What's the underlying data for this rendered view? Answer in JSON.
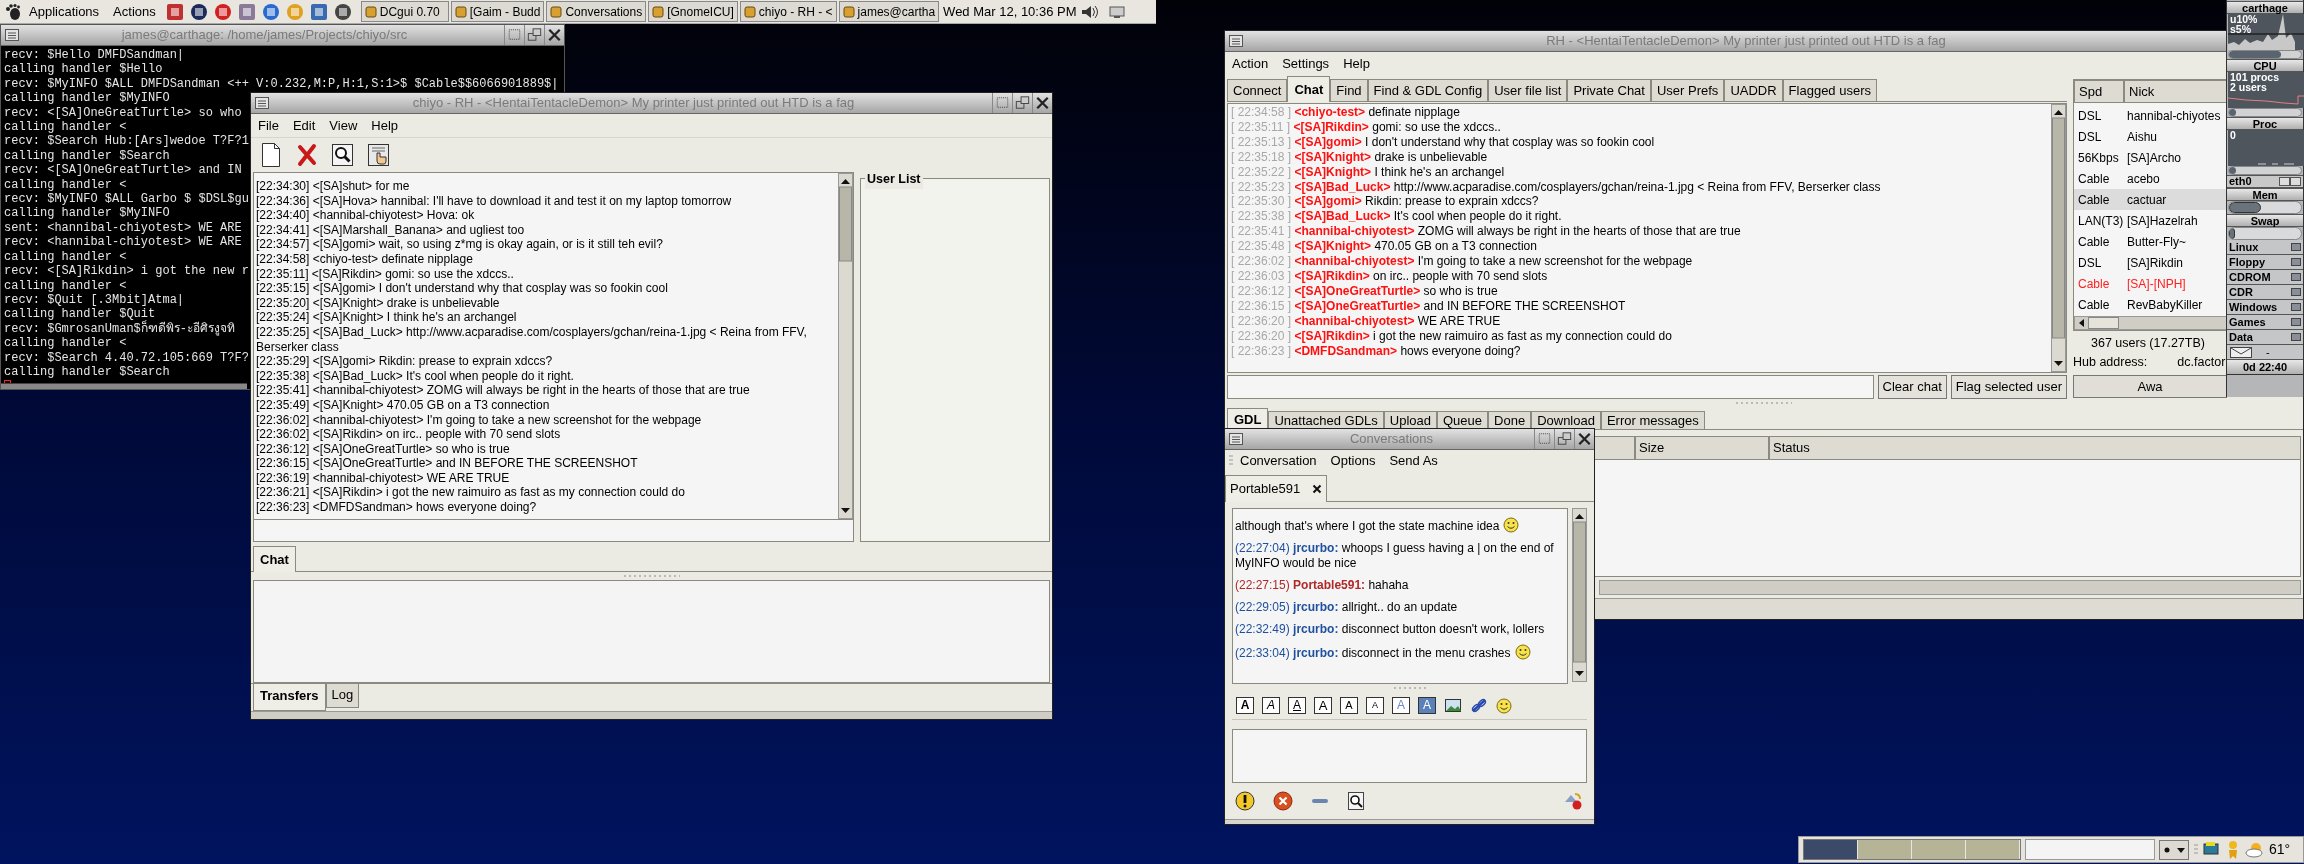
{
  "top_panel": {
    "menus": [
      "Applications",
      "Actions"
    ],
    "tasks": [
      "DCgui 0.70",
      "[Gaim - Budd",
      "Conversations",
      "[GnomeICU]",
      "chiyo - RH - <",
      "james@cartha"
    ],
    "clock": "Wed Mar 12, 10:36 PM"
  },
  "terminal": {
    "title": "james@carthage: /home/james/Projects/chiyo/src",
    "lines": [
      "recv: $Hello DMFDSandman|",
      "calling handler $Hello",
      "recv: $MyINFO $ALL DMFDSandman <++ V:0.232,M:P,H:1,S:1>$ $Cable$$6066901889$|",
      "calling handler $MyINFO",
      "recv: <[SA]OneGreatTurtle> so who",
      "calling handler <",
      "recv: $Search Hub:[Ars]wedoe T?F?1",
      "calling handler $Search",
      "recv: <[SA]OneGreatTurtle> and IN",
      "calling handler <",
      "recv: $MyINFO $ALL Garbo $ $DSL$gu",
      "calling handler $MyINFO",
      "sent: <hannibal-chiyotest> WE ARE",
      "recv: <hannibal-chiyotest> WE ARE",
      "calling handler <",
      "recv: <[SA]Rikdin> i got the new r",
      "calling handler <",
      "recv: $Quit [.3Mbit]Atma|",
      "calling handler $Quit",
      "recv: $GmrosanUman$ก็ฑดีพิร-ะอีศิรงูจทิ",
      "calling handler <",
      "recv: $Search 4.40.72.105:669 T?F?",
      "calling handler $Search"
    ]
  },
  "chiyo": {
    "title": "chiyo - RH - <HentaiTentacleDemon> My printer just printed out HTD is a fag",
    "menus": [
      "File",
      "Edit",
      "View",
      "Help"
    ],
    "lines": [
      "[22:34:30] <[SA]shut> for me",
      "[22:34:36] <[SA]Hova> hannibal:  I'll have to download it and test it on my laptop tomorrow",
      "[22:34:40] <hannibal-chiyotest> Hova: ok",
      "[22:34:41] <[SA]Marshall_Banana> and ugliest too",
      "[22:34:57] <[SA]gomi> wait, so using z*mg is okay again, or is it still teh evil?",
      "[22:34:58] <chiyo-test> definate nipplage",
      "[22:35:11] <[SA]Rikdin> gomi: so use the xdccs..",
      "[22:35:15] <[SA]gomi> I don't understand why that cosplay was so fookin cool",
      "[22:35:20] <[SA]Knight> drake is unbelievable",
      "[22:35:24] <[SA]Knight> I think he's an archangel",
      "[22:35:25] <[SA]Bad_Luck> http://www.acparadise.com/cosplayers/gchan/reina-1.jpg < Reina from FFV, Berserker class",
      "[22:35:29] <[SA]gomi> Rikdin: prease to exprain xdccs?",
      "[22:35:38] <[SA]Bad_Luck> It's cool when people do it right.",
      "[22:35:41] <hannibal-chiyotest> ZOMG will always be right in the hearts of those that are true",
      "[22:35:49] <[SA]Knight> 470.05 GB on a T3 connection",
      "[22:36:02] <hannibal-chiyotest> I'm going to take a new screenshot for the webpage",
      "[22:36:02] <[SA]Rikdin> on irc.. people with 70 send slots",
      "[22:36:12] <[SA]OneGreatTurtle> so who is true",
      "[22:36:15] <[SA]OneGreatTurtle> and IN BEFORE THE SCREENSHOT",
      "[22:36:19] <hannibal-chiyotest> WE ARE TRUE",
      "[22:36:21] <[SA]Rikdin> i got the new raimuiro as fast as my connection could do",
      "[22:36:23] <DMFDSandman> hows everyone doing?"
    ],
    "user_list_title": "User List",
    "chat_tabs": [
      {
        "label": "Chat",
        "selected": true
      }
    ],
    "bottom_tabs": [
      {
        "label": "Transfers",
        "selected": true
      },
      {
        "label": "Log",
        "selected": false
      }
    ]
  },
  "rh": {
    "title": "RH - <HentaiTentacleDemon> My printer just printed out HTD is a fag",
    "menus": [
      "Action",
      "Settings",
      "Help"
    ],
    "tabs": [
      {
        "label": "Connect",
        "selected": false
      },
      {
        "label": "Chat",
        "selected": true
      },
      {
        "label": "Find",
        "selected": false
      },
      {
        "label": "Find & GDL Config",
        "selected": false
      },
      {
        "label": "User file list",
        "selected": false
      },
      {
        "label": "Private Chat",
        "selected": false
      },
      {
        "label": "User Prefs",
        "selected": false
      },
      {
        "label": "UADDR",
        "selected": false
      },
      {
        "label": "Flagged users",
        "selected": false
      }
    ],
    "messages": [
      {
        "time": "[ 22:34:58 ]",
        "nick": "<chiyo-test>",
        "text": "definate nipplage"
      },
      {
        "time": "[ 22:35:11 ]",
        "nick": "<[SA]Rikdin>",
        "text": "gomi: so use the xdccs.."
      },
      {
        "time": "[ 22:35:13 ]",
        "nick": "<[SA]gomi>",
        "text": "I don't understand why that cosplay was so fookin cool"
      },
      {
        "time": "[ 22:35:18 ]",
        "nick": "<[SA]Knight>",
        "text": "drake is unbelievable"
      },
      {
        "time": "[ 22:35:22 ]",
        "nick": "<[SA]Knight>",
        "text": "I think he's an archangel"
      },
      {
        "time": "[ 22:35:23 ]",
        "nick": "<[SA]Bad_Luck>",
        "text": "http://www.acparadise.com/cosplayers/gchan/reina-1.jpg < Reina from FFV, Berserker class"
      },
      {
        "time": "[ 22:35:30 ]",
        "nick": "<[SA]gomi>",
        "text": "Rikdin: prease to exprain xdccs?"
      },
      {
        "time": "[ 22:35:38 ]",
        "nick": "<[SA]Bad_Luck>",
        "text": "It's cool when people do it right."
      },
      {
        "time": "[ 22:35:41 ]",
        "nick": "<hannibal-chiyotest>",
        "text": "ZOMG will always be right in the hearts of those that are true"
      },
      {
        "time": "[ 22:35:48 ]",
        "nick": "<[SA]Knight>",
        "text": "470.05 GB on a T3 connection"
      },
      {
        "time": "[ 22:36:02 ]",
        "nick": "<hannibal-chiyotest>",
        "text": "I'm going to take a new screenshot for the webpage"
      },
      {
        "time": "[ 22:36:03 ]",
        "nick": "<[SA]Rikdin>",
        "text": "on irc.. people with 70 send slots"
      },
      {
        "time": "[ 22:36:12 ]",
        "nick": "<[SA]OneGreatTurtle>",
        "text": "so who is true"
      },
      {
        "time": "[ 22:36:15 ]",
        "nick": "<[SA]OneGreatTurtle>",
        "text": "and IN BEFORE THE SCREENSHOT"
      },
      {
        "time": "[ 22:36:20 ]",
        "nick": "<hannibal-chiyotest>",
        "text": "WE ARE TRUE"
      },
      {
        "time": "[ 22:36:20 ]",
        "nick": "<[SA]Rikdin>",
        "text": "i got the new raimuiro as fast as my connection could do"
      },
      {
        "time": "[ 22:36:23 ]",
        "nick": "<DMFDSandman>",
        "text": "hows everyone doing?"
      }
    ],
    "buttons": [
      "Clear chat",
      "Flag selected user"
    ],
    "user_columns": [
      "Spd",
      "Nick"
    ],
    "users": [
      {
        "speed": "DSL",
        "nick": "hannibal-chiyotes",
        "selected": false,
        "color": "#000000"
      },
      {
        "speed": "DSL",
        "nick": "Aishu",
        "selected": false,
        "color": "#000000"
      },
      {
        "speed": "56Kbps",
        "nick": "[SA]Archo",
        "selected": false,
        "color": "#000000"
      },
      {
        "speed": "Cable",
        "nick": "acebo",
        "selected": false,
        "color": "#000000"
      },
      {
        "speed": "Cable",
        "nick": "cactuar",
        "selected": true,
        "color": "#000000"
      },
      {
        "speed": "LAN(T3)",
        "nick": "[SA]Hazelrah",
        "selected": false,
        "color": "#000000"
      },
      {
        "speed": "Cable",
        "nick": "Butter-Fly~",
        "selected": false,
        "color": "#000000"
      },
      {
        "speed": "DSL",
        "nick": "[SA]Rikdin",
        "selected": false,
        "color": "#000000"
      },
      {
        "speed": "Cable",
        "nick": "[SA]-[NPH]",
        "selected": false,
        "color": "#ff2020"
      },
      {
        "speed": "Cable",
        "nick": "RevBabyKiller",
        "selected": false,
        "color": "#000000"
      }
    ],
    "user_count": "367 users (17.27TB)",
    "hub_label": "Hub address:",
    "hub_value": "dc.factor",
    "away_button": "Awa",
    "transfer_tabs": [
      {
        "label": "GDL",
        "selected": true
      },
      {
        "label": "Unattached GDLs",
        "selected": false
      },
      {
        "label": "Upload",
        "selected": false
      },
      {
        "label": "Queue",
        "selected": false
      },
      {
        "label": "Done",
        "selected": false
      },
      {
        "label": "Download",
        "selected": false
      },
      {
        "label": "Error messages",
        "selected": false
      }
    ],
    "transfer_columns": [
      "Size",
      "Status"
    ]
  },
  "conversations": {
    "title": "Conversations",
    "menus": [
      "Conversation",
      "Options",
      "Send As"
    ],
    "tab": "Portable591",
    "messages": [
      {
        "kind": "continuation",
        "text": "although that's where I got the state machine idea",
        "has_smiley": true
      },
      {
        "kind": "message",
        "time": "(22:27:04)",
        "sender": "jrcurbo:",
        "text": "whoops I guess having a | on the end of MyINFO would be nice",
        "color": "#1f4f9f",
        "has_smiley": false
      },
      {
        "kind": "message",
        "time": "(22:27:15)",
        "sender": "Portable591:",
        "text": "hahaha",
        "color": "#b02828",
        "has_smiley": false
      },
      {
        "kind": "message",
        "time": "(22:29:05)",
        "sender": "jrcurbo:",
        "text": "allright.. do an update",
        "color": "#1f4f9f",
        "has_smiley": false
      },
      {
        "kind": "message",
        "time": "(22:32:49)",
        "sender": "jrcurbo:",
        "text": "disconnect button doesn't work, lollers",
        "color": "#1f4f9f",
        "has_smiley": false
      },
      {
        "kind": "message",
        "time": "(22:33:04)",
        "sender": "jrcurbo:",
        "text": "disconnect in the menu crashes",
        "color": "#1f4f9f",
        "has_smiley": true
      }
    ],
    "format_buttons": [
      {
        "kind": "bold",
        "glyph": "A"
      },
      {
        "kind": "italic",
        "glyph": "A"
      },
      {
        "kind": "underline",
        "glyph": "A"
      },
      {
        "kind": "larger",
        "glyph": "A"
      },
      {
        "kind": "normal",
        "glyph": "A"
      },
      {
        "kind": "smaller",
        "glyph": "A"
      },
      {
        "kind": "foreground",
        "glyph": "A"
      },
      {
        "kind": "background",
        "glyph": "A"
      }
    ]
  },
  "monitor": {
    "host": "carthage",
    "cpu_readings": [
      "u10%",
      "s5%"
    ],
    "cpu_label": "CPU",
    "proc_readings": [
      "101 procs",
      "2 users"
    ],
    "proc_label": "Proc",
    "net_reading": "0",
    "net_label": "eth0",
    "sliders": [
      {
        "level": 0.72
      },
      {
        "level": 0.03
      },
      {
        "level": 0.03
      }
    ],
    "mem": {
      "label": "Mem",
      "level": 0.45
    },
    "swap": {
      "label": "Swap",
      "level": 0.08
    },
    "mounts": [
      "Linux",
      "Floppy",
      "CDROM",
      "CDR",
      "Windows",
      "Games",
      "Data"
    ],
    "mail": "-",
    "uptime": "0d 22:40"
  },
  "bottom_panel": {
    "workspaces": [
      {
        "selected": true
      },
      {
        "selected": false
      },
      {
        "selected": false
      },
      {
        "selected": false
      }
    ],
    "temperature": "61°"
  }
}
